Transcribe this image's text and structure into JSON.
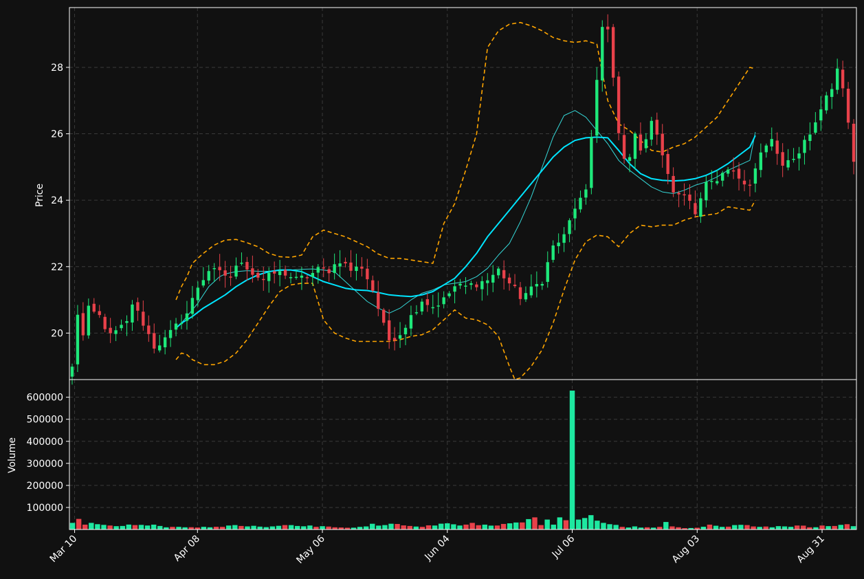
{
  "chart_data": {
    "type": "candlestick",
    "colors": {
      "background": "#111111",
      "up": "#1ee87a",
      "down": "#e8414a",
      "volume_up": "#1ee8a0",
      "volume_down": "#e8414a",
      "ma_fast": "#35d7d7",
      "ma_slow": "#00e5ff",
      "bollinger": "#ffa500",
      "grid": "#3a3a3a",
      "axis": "#ffffff"
    },
    "price_panel": {
      "ylabel": "Price",
      "ylim": [
        18.6,
        29.8
      ],
      "yticks": [
        20,
        22,
        24,
        26,
        28
      ],
      "ytick_labels": [
        "20",
        "22",
        "24",
        "26",
        "28"
      ],
      "grid": true
    },
    "volume_panel": {
      "ylabel": "Volume",
      "ylim": [
        0,
        680000
      ],
      "yticks": [
        100000,
        200000,
        300000,
        400000,
        500000,
        600000
      ],
      "ytick_labels": [
        "100000",
        "200000",
        "300000",
        "400000",
        "500000",
        "600000"
      ],
      "grid": true
    },
    "xaxis": {
      "index_range": [
        -0.5,
        125.5
      ],
      "ticks": [
        0,
        20,
        40,
        60,
        80,
        100,
        120
      ],
      "tick_labels": [
        "Mar 10",
        "Apr 08",
        "May 06",
        "Jun 04",
        "Jul 06",
        "Aug 03",
        "Aug 31"
      ]
    },
    "anchors": {
      "close": [
        [
          0,
          18.95
        ],
        [
          1,
          20.6
        ],
        [
          2,
          19.9
        ],
        [
          3,
          20.7
        ],
        [
          5,
          20.5
        ],
        [
          7,
          19.9
        ],
        [
          10,
          20.3
        ],
        [
          11,
          20.9
        ],
        [
          13,
          20.3
        ],
        [
          15,
          19.6
        ],
        [
          17,
          19.8
        ],
        [
          19,
          20.2
        ],
        [
          21,
          20.6
        ],
        [
          23,
          21.4
        ],
        [
          25,
          21.9
        ],
        [
          27,
          21.8
        ],
        [
          29,
          21.7
        ],
        [
          31,
          22.2
        ],
        [
          33,
          21.8
        ],
        [
          35,
          21.6
        ],
        [
          37,
          21.8
        ],
        [
          39,
          21.8
        ],
        [
          41,
          21.6
        ],
        [
          43,
          21.7
        ],
        [
          45,
          21.9
        ],
        [
          47,
          21.9
        ],
        [
          49,
          22.2
        ],
        [
          51,
          21.9
        ],
        [
          53,
          22.0
        ],
        [
          55,
          21.3
        ],
        [
          57,
          20.2
        ],
        [
          58,
          19.8
        ],
        [
          60,
          20.0
        ],
        [
          62,
          20.5
        ],
        [
          64,
          21.0
        ],
        [
          66,
          20.8
        ],
        [
          68,
          21.0
        ],
        [
          70,
          21.4
        ],
        [
          72,
          21.4
        ],
        [
          74,
          21.5
        ],
        [
          76,
          21.6
        ],
        [
          78,
          21.9
        ],
        [
          80,
          21.5
        ],
        [
          82,
          21.1
        ],
        [
          84,
          21.3
        ],
        [
          86,
          21.6
        ],
        [
          88,
          22.6
        ],
        [
          90,
          22.9
        ],
        [
          92,
          23.8
        ],
        [
          94,
          24.2
        ],
        [
          95,
          25.9
        ],
        [
          96,
          27.7
        ],
        [
          97,
          29.2
        ],
        [
          98,
          29.1
        ],
        [
          99,
          27.6
        ],
        [
          100,
          26.0
        ],
        [
          101,
          25.2
        ],
        [
          102,
          25.4
        ],
        [
          103,
          25.9
        ],
        [
          104,
          25.6
        ],
        [
          105,
          25.9
        ],
        [
          106,
          26.4
        ],
        [
          107,
          25.9
        ],
        [
          108,
          25.4
        ],
        [
          109,
          24.7
        ],
        [
          110,
          24.3
        ],
        [
          111,
          24.1
        ],
        [
          112,
          24.2
        ],
        [
          113,
          24.0
        ],
        [
          114,
          23.7
        ],
        [
          116,
          24.5
        ],
        [
          118,
          24.5
        ],
        [
          120,
          24.9
        ],
        [
          122,
          24.7
        ],
        [
          124,
          24.5
        ],
        [
          126,
          25.4
        ],
        [
          128,
          25.8
        ],
        [
          130,
          25.0
        ],
        [
          132,
          25.2
        ],
        [
          134,
          25.8
        ],
        [
          136,
          26.3
        ],
        [
          138,
          27.2
        ],
        [
          139,
          27.3
        ],
        [
          140,
          28.0
        ],
        [
          141,
          27.4
        ],
        [
          142,
          26.4
        ],
        [
          143,
          25.2
        ]
      ],
      "volume": [
        [
          0,
          30000
        ],
        [
          1,
          48000
        ],
        [
          2,
          22000
        ],
        [
          3,
          30000
        ],
        [
          4,
          24000
        ],
        [
          6,
          18000
        ],
        [
          8,
          16000
        ],
        [
          10,
          20000
        ],
        [
          12,
          18000
        ],
        [
          14,
          16000
        ],
        [
          16,
          12000
        ],
        [
          18,
          10000
        ],
        [
          20,
          9000
        ],
        [
          22,
          10000
        ],
        [
          24,
          12000
        ],
        [
          26,
          20000
        ],
        [
          28,
          14000
        ],
        [
          30,
          13000
        ],
        [
          32,
          14000
        ],
        [
          34,
          20000
        ],
        [
          36,
          16000
        ],
        [
          38,
          18000
        ],
        [
          40,
          15000
        ],
        [
          42,
          10000
        ],
        [
          44,
          8000
        ],
        [
          46,
          12000
        ],
        [
          48,
          26000
        ],
        [
          50,
          20000
        ],
        [
          52,
          25000
        ],
        [
          54,
          16000
        ],
        [
          56,
          12000
        ],
        [
          58,
          18000
        ],
        [
          60,
          28000
        ],
        [
          62,
          18000
        ],
        [
          64,
          30000
        ],
        [
          66,
          22000
        ],
        [
          68,
          18000
        ],
        [
          70,
          28000
        ],
        [
          72,
          32000
        ],
        [
          74,
          55000
        ],
        [
          75,
          20000
        ],
        [
          76,
          45000
        ],
        [
          77,
          22000
        ],
        [
          78,
          55000
        ],
        [
          79,
          42000
        ],
        [
          80,
          630000
        ],
        [
          81,
          45000
        ],
        [
          82,
          52000
        ],
        [
          83,
          65000
        ],
        [
          84,
          40000
        ],
        [
          85,
          30000
        ],
        [
          86,
          24000
        ],
        [
          88,
          12000
        ],
        [
          90,
          14000
        ],
        [
          92,
          10000
        ],
        [
          94,
          12000
        ],
        [
          95,
          34000
        ],
        [
          96,
          14000
        ],
        [
          98,
          6000
        ],
        [
          100,
          8000
        ],
        [
          102,
          22000
        ],
        [
          104,
          12000
        ],
        [
          106,
          20000
        ],
        [
          108,
          20000
        ],
        [
          110,
          12000
        ],
        [
          112,
          10000
        ],
        [
          114,
          14000
        ],
        [
          116,
          18000
        ],
        [
          118,
          10000
        ],
        [
          120,
          18000
        ],
        [
          122,
          16000
        ],
        [
          124,
          24000
        ],
        [
          125,
          15000
        ]
      ]
    },
    "series": [
      {
        "type": "ohlc",
        "n": 126
      },
      {
        "type": "line",
        "style": "solid",
        "width": 1,
        "color_key": "ma_fast",
        "x": [
          19,
          20,
          21,
          22,
          23,
          24,
          25,
          26,
          27,
          28,
          30,
          32,
          34,
          36,
          38,
          40,
          42,
          44,
          46,
          48,
          50,
          52,
          54,
          56,
          58,
          60,
          62,
          64,
          66,
          68,
          70,
          72,
          74,
          76,
          78,
          80,
          82,
          84,
          86,
          88,
          90,
          92,
          94,
          96,
          98,
          100,
          102,
          104,
          106,
          108,
          110,
          112,
          114,
          116,
          118,
          120,
          122,
          124,
          125
        ],
        "y": [
          20.15,
          20.3,
          20.5,
          20.7,
          20.9,
          21.15,
          21.4,
          21.55,
          21.7,
          21.78,
          21.85,
          21.88,
          21.86,
          21.86,
          21.88,
          21.9,
          21.92,
          21.93,
          21.9,
          21.85,
          21.55,
          21.25,
          20.95,
          20.75,
          20.6,
          20.75,
          21.0,
          21.2,
          21.3,
          21.45,
          21.5,
          21.55,
          21.7,
          21.95,
          22.35,
          22.7,
          23.35,
          24.1,
          25.0,
          25.9,
          26.55,
          26.7,
          26.5,
          26.1,
          25.7,
          25.2,
          24.9,
          24.65,
          24.4,
          24.25,
          24.2,
          24.3,
          24.45,
          24.55,
          24.7,
          24.9,
          25.05,
          25.2,
          26.05
        ]
      },
      {
        "type": "line",
        "style": "solid",
        "width": 2,
        "color_key": "ma_slow",
        "x": [
          19,
          20,
          22,
          24,
          26,
          28,
          30,
          32,
          34,
          36,
          38,
          40,
          42,
          44,
          46,
          48,
          50,
          52,
          54,
          56,
          58,
          60,
          62,
          64,
          66,
          68,
          70,
          72,
          74,
          76,
          78,
          80,
          82,
          84,
          86,
          88,
          90,
          92,
          94,
          96,
          98,
          100,
          102,
          104,
          106,
          108,
          110,
          112,
          114,
          116,
          118,
          120,
          122,
          124,
          125
        ],
        "y": [
          20.15,
          20.3,
          20.5,
          20.75,
          20.95,
          21.15,
          21.4,
          21.6,
          21.75,
          21.85,
          21.9,
          21.9,
          21.85,
          21.7,
          21.55,
          21.45,
          21.35,
          21.3,
          21.28,
          21.22,
          21.15,
          21.12,
          21.1,
          21.15,
          21.25,
          21.45,
          21.65,
          22.0,
          22.4,
          22.9,
          23.3,
          23.7,
          24.1,
          24.5,
          24.9,
          25.3,
          25.6,
          25.8,
          25.88,
          25.9,
          25.88,
          25.5,
          25.1,
          24.8,
          24.65,
          24.6,
          24.58,
          24.6,
          24.65,
          24.75,
          24.9,
          25.1,
          25.35,
          25.6,
          25.95
        ]
      },
      {
        "type": "line",
        "style": "dashed",
        "width": 1.6,
        "color_key": "bollinger",
        "x": [
          19,
          20,
          21,
          22,
          24,
          26,
          28,
          30,
          32,
          34,
          36,
          38,
          40,
          42,
          44,
          46,
          48,
          50,
          52,
          54,
          56,
          58,
          60,
          62,
          64,
          66,
          68,
          70,
          72,
          74,
          76,
          78,
          80,
          82,
          84,
          86,
          88,
          90,
          92,
          94,
          96,
          98,
          100,
          102,
          104,
          106,
          108,
          110,
          112,
          114,
          116,
          118,
          120,
          122,
          124,
          125
        ],
        "y": [
          21.0,
          21.4,
          21.7,
          22.1,
          22.4,
          22.65,
          22.8,
          22.82,
          22.72,
          22.6,
          22.4,
          22.3,
          22.28,
          22.35,
          22.9,
          23.1,
          23.0,
          22.9,
          22.75,
          22.6,
          22.38,
          22.25,
          22.25,
          22.2,
          22.15,
          22.1,
          23.3,
          23.9,
          24.9,
          26.0,
          28.6,
          29.1,
          29.3,
          29.35,
          29.25,
          29.1,
          28.9,
          28.8,
          28.75,
          28.8,
          28.7,
          27.0,
          26.3,
          26.1,
          25.8,
          25.5,
          25.45,
          25.6,
          25.7,
          25.9,
          26.2,
          26.5,
          27.0,
          27.5,
          28.0,
          27.95
        ]
      },
      {
        "type": "line",
        "style": "dashed",
        "width": 1.6,
        "color_key": "bollinger",
        "x": [
          19,
          20,
          21,
          22,
          24,
          26,
          28,
          30,
          32,
          34,
          36,
          38,
          40,
          42,
          44,
          46,
          48,
          50,
          52,
          54,
          56,
          58,
          60,
          62,
          64,
          66,
          68,
          70,
          72,
          74,
          76,
          78,
          80,
          81,
          82,
          84,
          86,
          88,
          90,
          92,
          94,
          96,
          98,
          100,
          102,
          104,
          106,
          108,
          110,
          112,
          114,
          116,
          118,
          120,
          122,
          124,
          125
        ],
        "y": [
          19.2,
          19.4,
          19.35,
          19.2,
          19.05,
          19.05,
          19.15,
          19.4,
          19.8,
          20.3,
          20.8,
          21.25,
          21.45,
          21.5,
          21.5,
          20.4,
          20.0,
          19.85,
          19.75,
          19.75,
          19.75,
          19.75,
          19.8,
          19.9,
          19.95,
          20.1,
          20.4,
          20.7,
          20.45,
          20.4,
          20.25,
          19.9,
          19.0,
          18.4,
          18.65,
          19.0,
          19.5,
          20.3,
          21.3,
          22.2,
          22.75,
          22.95,
          22.9,
          22.6,
          23.0,
          23.25,
          23.2,
          23.25,
          23.25,
          23.4,
          23.5,
          23.55,
          23.6,
          23.8,
          23.75,
          23.7,
          24.0
        ]
      }
    ]
  }
}
